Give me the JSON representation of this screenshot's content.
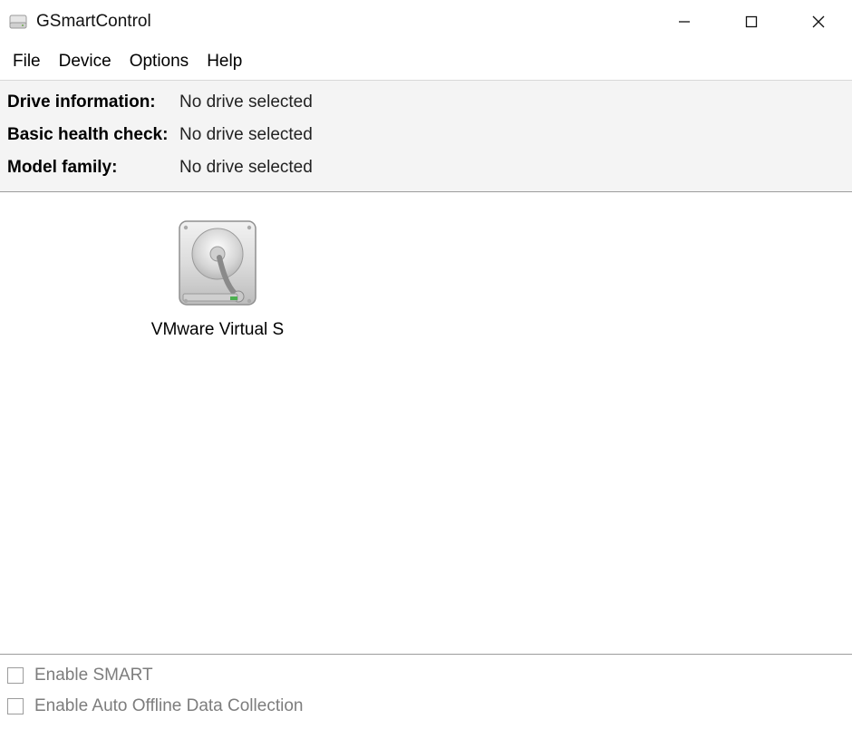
{
  "window": {
    "title": "GSmartControl",
    "icon": "hard-drive-icon"
  },
  "menu": {
    "items": [
      "File",
      "Device",
      "Options",
      "Help"
    ]
  },
  "info": {
    "rows": [
      {
        "label": "Drive information:",
        "value": "No drive selected"
      },
      {
        "label": "Basic health check:",
        "value": "No drive selected"
      },
      {
        "label": "Model family:",
        "value": "No drive selected"
      }
    ]
  },
  "drives": [
    {
      "label": "VMware Virtual S",
      "icon": "hard-drive-icon"
    }
  ],
  "bottom": {
    "enable_smart": "Enable SMART",
    "enable_auto_offline": "Enable Auto Offline Data Collection"
  }
}
